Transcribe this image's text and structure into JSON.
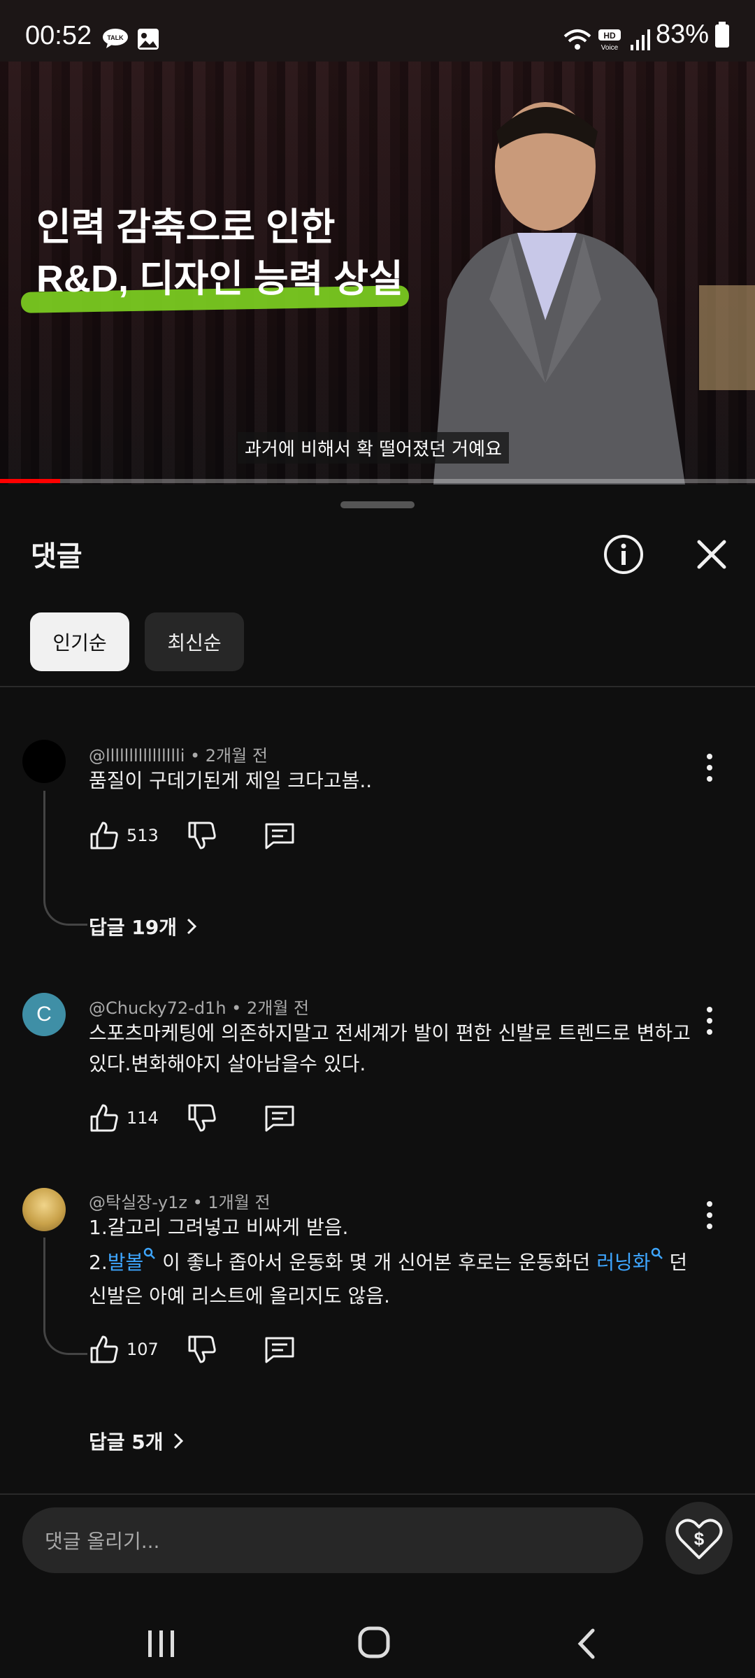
{
  "status_bar": {
    "time": "00:52",
    "battery": "83%",
    "icons": [
      "talk-icon",
      "gallery-icon",
      "wifi-icon",
      "hd-voice-icon",
      "signal-icon",
      "battery-icon"
    ]
  },
  "video": {
    "overlay_line1": "인력 감축으로 인한",
    "overlay_line2": "R&D, 디자인 능력 상실",
    "subtitle": "과거에 비해서 확 떨어졌던 거예요",
    "progress_fraction": 0.08
  },
  "sheet": {
    "title": "댓글",
    "sort_tabs": [
      {
        "label": "인기순",
        "active": true
      },
      {
        "label": "최신순",
        "active": false
      }
    ]
  },
  "comments": [
    {
      "author": "@lllllllllllllllli",
      "time": "2개월 전",
      "text": "품질이 구데기된게 제일 크다고봄..",
      "likes": "513",
      "replies": "답글 19개",
      "avatar_color": "#000000"
    },
    {
      "author": "@Chucky72-d1h",
      "time": "2개월 전",
      "text": "스포츠마케팅에 의존하지말고 전세계가 발이 편한 신발로 트렌드로 변하고 있다.변화해야지 살아남을수 있다.",
      "likes": "114",
      "avatar_letter": "C",
      "avatar_color": "#3f8fa6"
    },
    {
      "author": "@탁실장-y1z",
      "time": "1개월 전",
      "line1": "1.갈고리 그려넣고 비싸게 받음.",
      "line2_prefix": "2.",
      "line2_link1": "발볼",
      "line2_mid": " 이 좋나 좁아서 운동화 몇 개 신어본 후로는 운동화던 ",
      "line2_link2": "러닝화",
      "line2_suffix": " 던",
      "line3": "신발은 아예 리스트에 올리지도 않음.",
      "likes": "107",
      "replies": "답글 5개",
      "avatar_color": "#c9a24a"
    }
  ],
  "composer": {
    "placeholder": "댓글 올리기..."
  },
  "colors": {
    "background": "#0f0f0f",
    "link": "#3ea6ff",
    "highlight": "#7ed321"
  }
}
